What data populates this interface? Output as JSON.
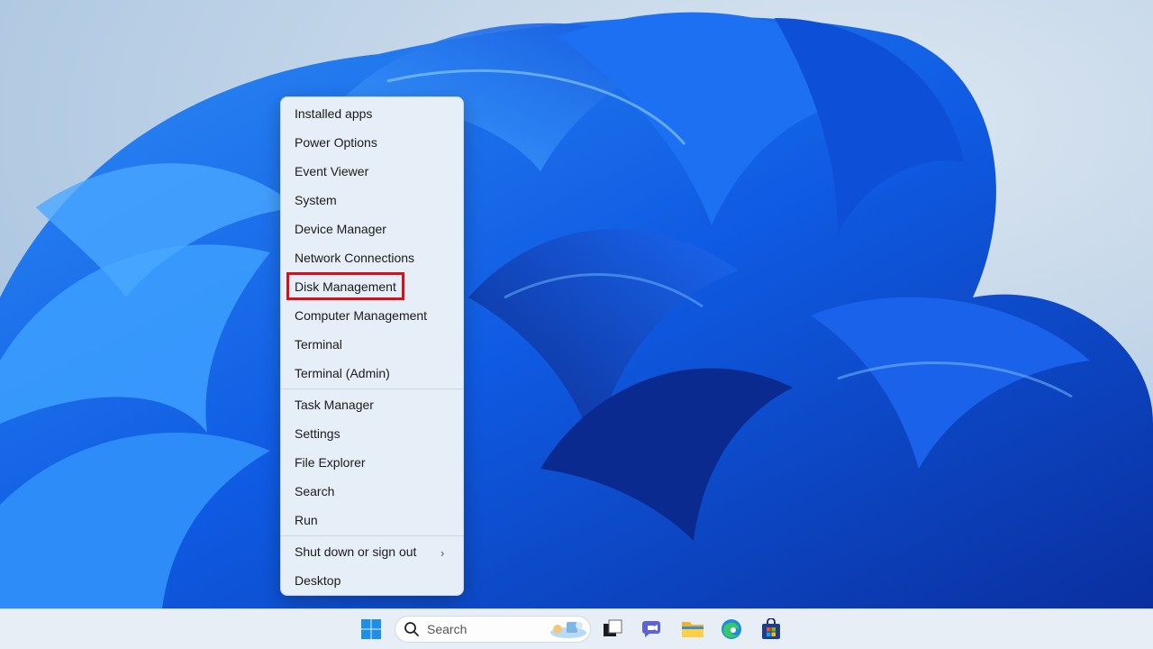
{
  "menu": {
    "items": [
      "Installed apps",
      "Power Options",
      "Event Viewer",
      "System",
      "Device Manager",
      "Network Connections",
      "Disk Management",
      "Computer Management",
      "Terminal",
      "Terminal (Admin)",
      "Task Manager",
      "Settings",
      "File Explorer",
      "Search",
      "Run",
      "Shut down or sign out",
      "Desktop"
    ],
    "highlighted": "Disk Management",
    "highlight_color": "#d2121b"
  },
  "taskbar": {
    "search_label": "Search",
    "icons": [
      "windows-start-icon",
      "search-icon",
      "task-view-icon",
      "chat-icon",
      "file-explorer-icon",
      "edge-icon",
      "store-icon"
    ]
  },
  "colors": {
    "menu_bg": "#e6eef8",
    "taskbar_bg": "#e7eef6",
    "wallpaper_blue": "#1560e8"
  }
}
